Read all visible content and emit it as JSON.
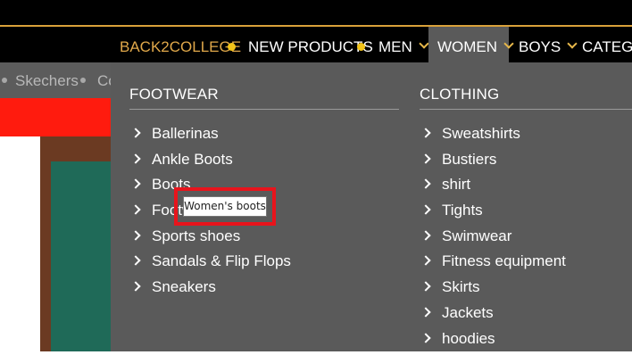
{
  "nav": {
    "items": [
      {
        "label": "BACK2COLLEGE",
        "accent": true
      },
      {
        "label": "NEW PRODUCTS"
      },
      {
        "label": "MEN"
      },
      {
        "label": "WOMEN",
        "active": true
      },
      {
        "label": "BOYS"
      },
      {
        "label": "CATEGO"
      }
    ]
  },
  "brands": [
    "Skechers",
    "Co"
  ],
  "menu": {
    "footwear": {
      "title": "FOOTWEAR",
      "items": [
        "Ballerinas",
        "Ankle Boots",
        "Boots",
        "Footwear",
        "Sports shoes",
        "Sandals & Flip Flops",
        "Sneakers"
      ]
    },
    "clothing": {
      "title": "CLOTHING",
      "items": [
        "Sweatshirts",
        "Bustiers",
        "shirt",
        "Tights",
        "Swimwear",
        "Fitness equipment",
        "Skirts",
        "Jackets",
        "hoodies"
      ]
    }
  },
  "tooltip": {
    "text": "Women's boots"
  },
  "colors": {
    "accent": "#e0a84a",
    "dot": "#f2c318",
    "highlight": "#e8141c",
    "promo": "#ff1b0e",
    "menu_bg": "#5a5a5a"
  }
}
